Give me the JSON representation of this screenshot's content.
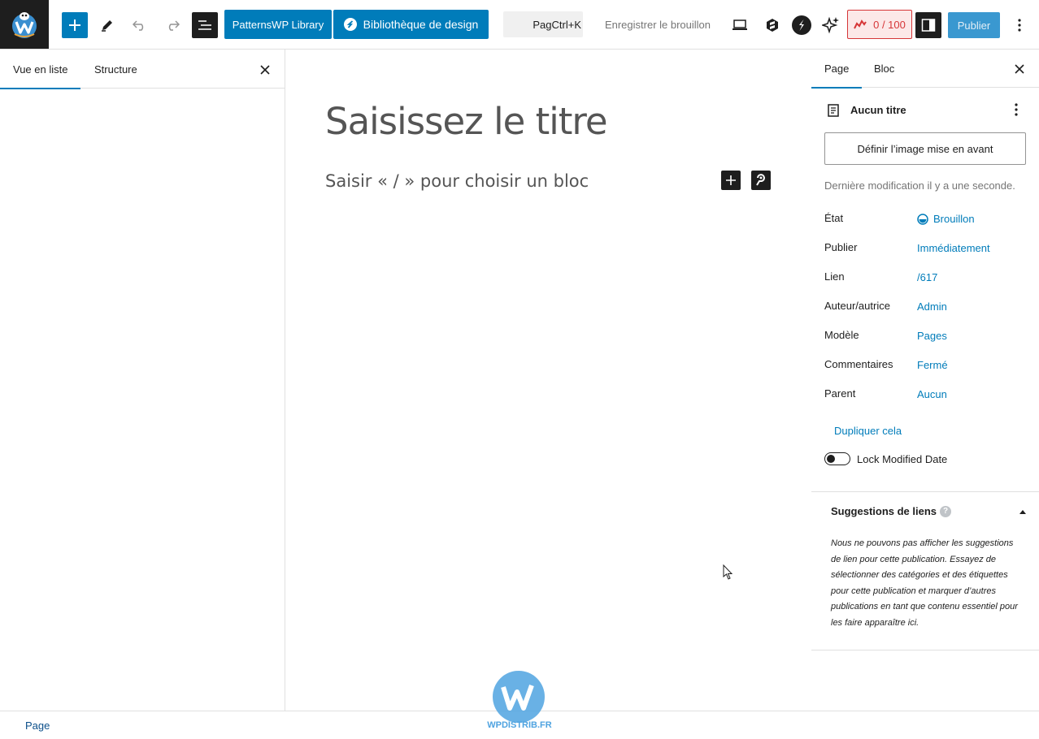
{
  "toolbar": {
    "patterns_label": "PatternsWP Library",
    "design_label": "Bibliothèque de design",
    "search_shortcut": "PagCtrl+K",
    "save_draft_label": "Enregistrer le brouillon",
    "score_label": "0 / 100",
    "publish_label": "Publier",
    "accent_color": "#007cba"
  },
  "left_panel": {
    "tabs": [
      {
        "label": "Vue en liste",
        "active": true
      },
      {
        "label": "Structure",
        "active": false
      }
    ]
  },
  "canvas": {
    "title_placeholder": "Saisissez le titre",
    "block_placeholder": "Saisir « / » pour choisir un bloc"
  },
  "sidebar": {
    "tabs": [
      {
        "label": "Page",
        "active": true
      },
      {
        "label": "Bloc",
        "active": false
      }
    ],
    "post_title": "Aucun titre",
    "featured_image_label": "Définir l’image mise en avant",
    "last_modified": "Dernière modification il y a une seconde.",
    "meta": [
      {
        "label": "État",
        "value": "Brouillon"
      },
      {
        "label": "Publier",
        "value": "Immédiatement"
      },
      {
        "label": "Lien",
        "value": "/617"
      },
      {
        "label": "Auteur/autrice",
        "value": "Admin"
      },
      {
        "label": "Modèle",
        "value": "Pages"
      },
      {
        "label": "Commentaires",
        "value": "Fermé"
      },
      {
        "label": "Parent",
        "value": "Aucun"
      }
    ],
    "duplicate_label": "Dupliquer cela",
    "lock_modified_label": "Lock Modified Date",
    "lock_modified_on": false,
    "suggestions": {
      "title": "Suggestions de liens",
      "help_glyph": "?",
      "text": "Nous ne pouvons pas afficher les suggestions de lien pour cette publication. Essayez de sélectionner des catégories et des étiquettes pour cette publication et marquer d’autres publications en tant que contenu essentiel pour les faire apparaître ici."
    }
  },
  "footer": {
    "breadcrumb": "Page"
  },
  "watermark": {
    "text": "WPDISTRIB.FR"
  }
}
